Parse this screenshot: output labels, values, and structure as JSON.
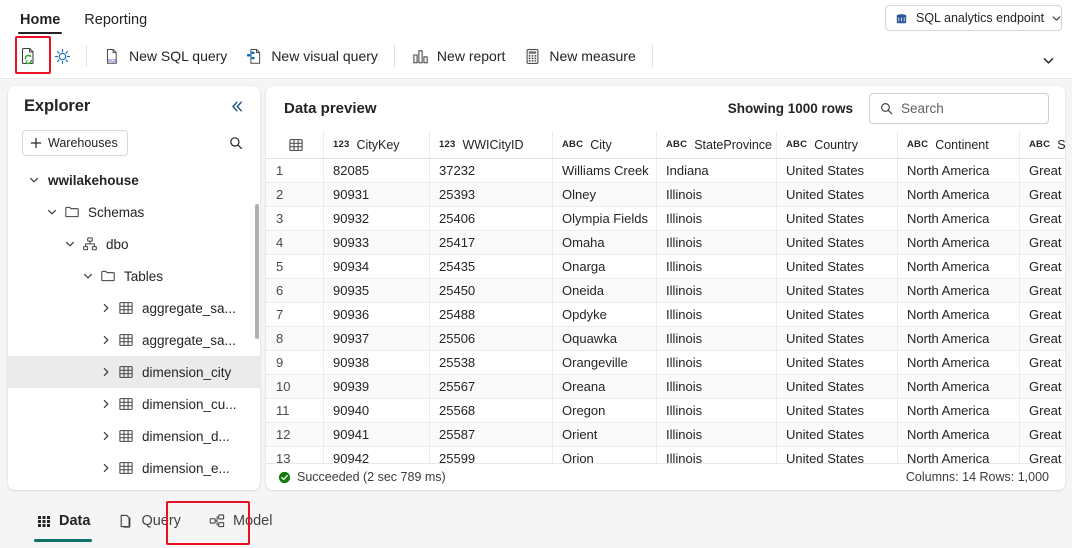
{
  "ribbon": {
    "tabs": [
      {
        "label": "Home",
        "active": true
      },
      {
        "label": "Reporting",
        "active": false
      }
    ],
    "endpoint": {
      "label": "SQL analytics endpoint",
      "icon": "database-icon",
      "chevron": "chevron-down-icon"
    }
  },
  "commandbar": {
    "refresh": {
      "label": "",
      "icon": "refresh-document-icon",
      "highlighted": true
    },
    "settings": {
      "label": "",
      "icon": "gear-icon"
    },
    "items": [
      {
        "label": "New SQL query",
        "icon": "sql-file-icon"
      },
      {
        "label": "New visual query",
        "icon": "visual-query-icon"
      },
      {
        "label": "New report",
        "icon": "bar-chart-icon"
      },
      {
        "label": "New measure",
        "icon": "calculator-icon"
      }
    ],
    "overflow_icon": "chevron-down-icon"
  },
  "explorer": {
    "title": "Explorer",
    "collapse_icon": "double-chevron-left-icon",
    "warehouses_button": "Warehouses",
    "add_icon": "plus-icon",
    "search_icon": "search-icon",
    "tree": [
      {
        "label": "wwilakehouse",
        "indent": 0,
        "icon": "none",
        "twist": "expanded",
        "bold": true,
        "selected": false
      },
      {
        "label": "Schemas",
        "indent": 1,
        "icon": "folder-icon",
        "twist": "expanded",
        "bold": false,
        "selected": false
      },
      {
        "label": "dbo",
        "indent": 2,
        "icon": "schema-icon",
        "twist": "expanded",
        "bold": false,
        "selected": false
      },
      {
        "label": "Tables",
        "indent": 3,
        "icon": "folder-icon",
        "twist": "expanded",
        "bold": false,
        "selected": false
      },
      {
        "label": "aggregate_sa...",
        "indent": 4,
        "icon": "table-icon",
        "twist": "collapsed",
        "bold": false,
        "selected": false
      },
      {
        "label": "aggregate_sa...",
        "indent": 4,
        "icon": "table-icon",
        "twist": "collapsed",
        "bold": false,
        "selected": false
      },
      {
        "label": "dimension_city",
        "indent": 4,
        "icon": "table-icon",
        "twist": "collapsed",
        "bold": false,
        "selected": true
      },
      {
        "label": "dimension_cu...",
        "indent": 4,
        "icon": "table-icon",
        "twist": "collapsed",
        "bold": false,
        "selected": false
      },
      {
        "label": "dimension_d...",
        "indent": 4,
        "icon": "table-icon",
        "twist": "collapsed",
        "bold": false,
        "selected": false
      },
      {
        "label": "dimension_e...",
        "indent": 4,
        "icon": "table-icon",
        "twist": "collapsed",
        "bold": false,
        "selected": false
      }
    ]
  },
  "preview": {
    "title": "Data preview",
    "showing": "Showing 1000 rows",
    "search_placeholder": "Search",
    "search_value": "",
    "search_icon": "search-icon",
    "grid_corner_icon": "table-icon",
    "columns": [
      {
        "name": "CityKey",
        "type": "123",
        "class": "c-key"
      },
      {
        "name": "WWICityID",
        "type": "123",
        "class": "c-wwi"
      },
      {
        "name": "City",
        "type": "ABC",
        "class": "c-city"
      },
      {
        "name": "StateProvince",
        "type": "ABC",
        "class": "c-state"
      },
      {
        "name": "Country",
        "type": "ABC",
        "class": "c-ctry"
      },
      {
        "name": "Continent",
        "type": "ABC",
        "class": "c-cont"
      },
      {
        "name": "Sal",
        "type": "ABC",
        "class": "c-sal"
      }
    ],
    "rows": [
      {
        "n": "1",
        "cells": [
          "82085",
          "37232",
          "Williams Creek",
          "Indiana",
          "United States",
          "North America",
          "Great La"
        ]
      },
      {
        "n": "2",
        "cells": [
          "90931",
          "25393",
          "Olney",
          "Illinois",
          "United States",
          "North America",
          "Great La"
        ]
      },
      {
        "n": "3",
        "cells": [
          "90932",
          "25406",
          "Olympia Fields",
          "Illinois",
          "United States",
          "North America",
          "Great La"
        ]
      },
      {
        "n": "4",
        "cells": [
          "90933",
          "25417",
          "Omaha",
          "Illinois",
          "United States",
          "North America",
          "Great La"
        ]
      },
      {
        "n": "5",
        "cells": [
          "90934",
          "25435",
          "Onarga",
          "Illinois",
          "United States",
          "North America",
          "Great La"
        ]
      },
      {
        "n": "6",
        "cells": [
          "90935",
          "25450",
          "Oneida",
          "Illinois",
          "United States",
          "North America",
          "Great La"
        ]
      },
      {
        "n": "7",
        "cells": [
          "90936",
          "25488",
          "Opdyke",
          "Illinois",
          "United States",
          "North America",
          "Great La"
        ]
      },
      {
        "n": "8",
        "cells": [
          "90937",
          "25506",
          "Oquawka",
          "Illinois",
          "United States",
          "North America",
          "Great La"
        ]
      },
      {
        "n": "9",
        "cells": [
          "90938",
          "25538",
          "Orangeville",
          "Illinois",
          "United States",
          "North America",
          "Great La"
        ]
      },
      {
        "n": "10",
        "cells": [
          "90939",
          "25567",
          "Oreana",
          "Illinois",
          "United States",
          "North America",
          "Great La"
        ]
      },
      {
        "n": "11",
        "cells": [
          "90940",
          "25568",
          "Oregon",
          "Illinois",
          "United States",
          "North America",
          "Great La"
        ]
      },
      {
        "n": "12",
        "cells": [
          "90941",
          "25587",
          "Orient",
          "Illinois",
          "United States",
          "North America",
          "Great La"
        ]
      },
      {
        "n": "13",
        "cells": [
          "90942",
          "25599",
          "Orion",
          "Illinois",
          "United States",
          "North America",
          "Great La"
        ]
      }
    ],
    "status": {
      "text": "Succeeded (2 sec 789 ms)",
      "icon": "success-check-icon",
      "counts": "Columns: 14 Rows: 1,000"
    }
  },
  "bottom_tabs": [
    {
      "label": "Data",
      "icon": "grid-icon",
      "active": true,
      "highlighted": false
    },
    {
      "label": "Query",
      "icon": "pages-icon",
      "active": false,
      "highlighted": false
    },
    {
      "label": "Model",
      "icon": "model-icon",
      "active": false,
      "highlighted": true
    }
  ],
  "colors": {
    "accent_teal": "#0f7268",
    "highlight_red": "#e81123",
    "success_green": "#107c10",
    "sql_purple": "#8661c5",
    "visual_blue": "#0f6cbd",
    "refresh_green": "#4caf50"
  }
}
